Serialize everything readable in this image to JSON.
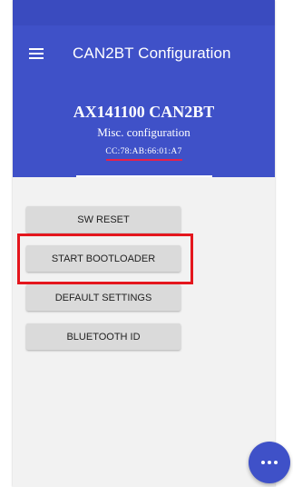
{
  "app_bar": {
    "title": "CAN2BT Configuration",
    "menu_icon": "hamburger-menu-icon"
  },
  "header": {
    "device_name": "AX141100 CAN2BT",
    "subtitle": "Misc. configuration",
    "mac_address": "CC:78:AB:66:01:A7"
  },
  "buttons": {
    "sw_reset": "SW RESET",
    "start_bootloader": "START BOOTLOADER",
    "default_settings": "DEFAULT SETTINGS",
    "bluetooth_id": "BLUETOOTH ID"
  },
  "fab": {
    "icon": "more-horizontal-icon"
  },
  "colors": {
    "primary": "#3f51c8",
    "highlight": "#e4161d",
    "accent_underline": "#e8204a"
  }
}
